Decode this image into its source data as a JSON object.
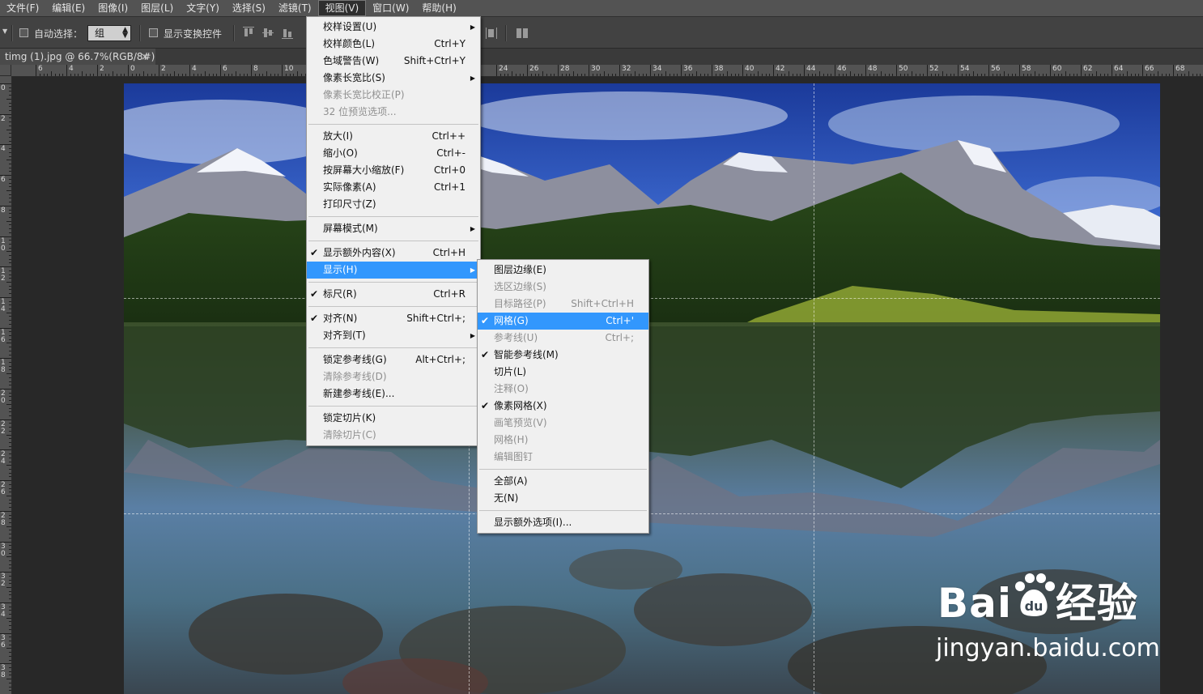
{
  "menubar": [
    "文件(F)",
    "编辑(E)",
    "图像(I)",
    "图层(L)",
    "文字(Y)",
    "选择(S)",
    "滤镜(T)",
    "视图(V)",
    "窗口(W)",
    "帮助(H)"
  ],
  "options": {
    "auto_select": "自动选择：",
    "group_value": "组",
    "show_transform": "显示变换控件"
  },
  "document_tab": {
    "title": "timg (1).jpg @ 66.7%(RGB/8#)",
    "close": "×"
  },
  "hruler_labels": [
    "6",
    "4",
    "2",
    "0",
    "2",
    "4",
    "6",
    "8",
    "10",
    "24",
    "26",
    "28",
    "30",
    "32",
    "34",
    "36",
    "38",
    "40",
    "42",
    "44",
    "46",
    "48",
    "50",
    "52",
    "54",
    "56",
    "58",
    "60",
    "62",
    "64",
    "66",
    "68"
  ],
  "vruler_labels": [
    "0",
    "2",
    "4",
    "6",
    "8",
    "1 0",
    "1 2",
    "1 4",
    "1 6",
    "1 8",
    "2 0",
    "2 2",
    "2 4",
    "2 6",
    "2 8",
    "3 0",
    "3 2",
    "3 4",
    "3 6",
    "3 8"
  ],
  "view_menu": [
    {
      "label": "校样设置(U)",
      "sub": true
    },
    {
      "label": "校样颜色(L)",
      "shortcut": "Ctrl+Y"
    },
    {
      "label": "色域警告(W)",
      "shortcut": "Shift+Ctrl+Y"
    },
    {
      "label": "像素长宽比(S)",
      "sub": true
    },
    {
      "label": "像素长宽比校正(P)",
      "disabled": true
    },
    {
      "label": "32 位预览选项...",
      "disabled": true
    },
    {
      "sep": true
    },
    {
      "label": "放大(I)",
      "shortcut": "Ctrl++"
    },
    {
      "label": "缩小(O)",
      "shortcut": "Ctrl+-"
    },
    {
      "label": "按屏幕大小缩放(F)",
      "shortcut": "Ctrl+0"
    },
    {
      "label": "实际像素(A)",
      "shortcut": "Ctrl+1"
    },
    {
      "label": "打印尺寸(Z)"
    },
    {
      "sep": true
    },
    {
      "label": "屏幕模式(M)",
      "sub": true
    },
    {
      "sep": true
    },
    {
      "label": "显示额外内容(X)",
      "shortcut": "Ctrl+H",
      "checked": true
    },
    {
      "label": "显示(H)",
      "sub": true,
      "highlight": true
    },
    {
      "sep": true
    },
    {
      "label": "标尺(R)",
      "shortcut": "Ctrl+R",
      "checked": true
    },
    {
      "sep": true
    },
    {
      "label": "对齐(N)",
      "shortcut": "Shift+Ctrl+;",
      "checked": true
    },
    {
      "label": "对齐到(T)",
      "sub": true
    },
    {
      "sep": true
    },
    {
      "label": "锁定参考线(G)",
      "shortcut": "Alt+Ctrl+;"
    },
    {
      "label": "清除参考线(D)",
      "disabled": true
    },
    {
      "label": "新建参考线(E)..."
    },
    {
      "sep": true
    },
    {
      "label": "锁定切片(K)"
    },
    {
      "label": "清除切片(C)",
      "disabled": true
    }
  ],
  "show_submenu": [
    {
      "label": "图层边缘(E)"
    },
    {
      "label": "选区边缘(S)",
      "disabled": true
    },
    {
      "label": "目标路径(P)",
      "shortcut": "Shift+Ctrl+H",
      "disabled": true
    },
    {
      "label": "网格(G)",
      "shortcut": "Ctrl+'",
      "checked": true,
      "highlight": true
    },
    {
      "label": "参考线(U)",
      "shortcut": "Ctrl+;",
      "disabled": true
    },
    {
      "label": "智能参考线(M)",
      "checked": true
    },
    {
      "label": "切片(L)"
    },
    {
      "label": "注释(O)",
      "disabled": true
    },
    {
      "label": "像素网格(X)",
      "checked": true
    },
    {
      "label": "画笔预览(V)",
      "disabled": true
    },
    {
      "label": "网格(H)",
      "disabled": true
    },
    {
      "label": "编辑图钉",
      "disabled": true
    },
    {
      "sep": true
    },
    {
      "label": "全部(A)"
    },
    {
      "label": "无(N)"
    },
    {
      "sep": true
    },
    {
      "label": "显示额外选项(I)..."
    }
  ],
  "watermark": {
    "brand": "Bai",
    "brand2": "经验",
    "url": "jingyan.baidu.com"
  }
}
